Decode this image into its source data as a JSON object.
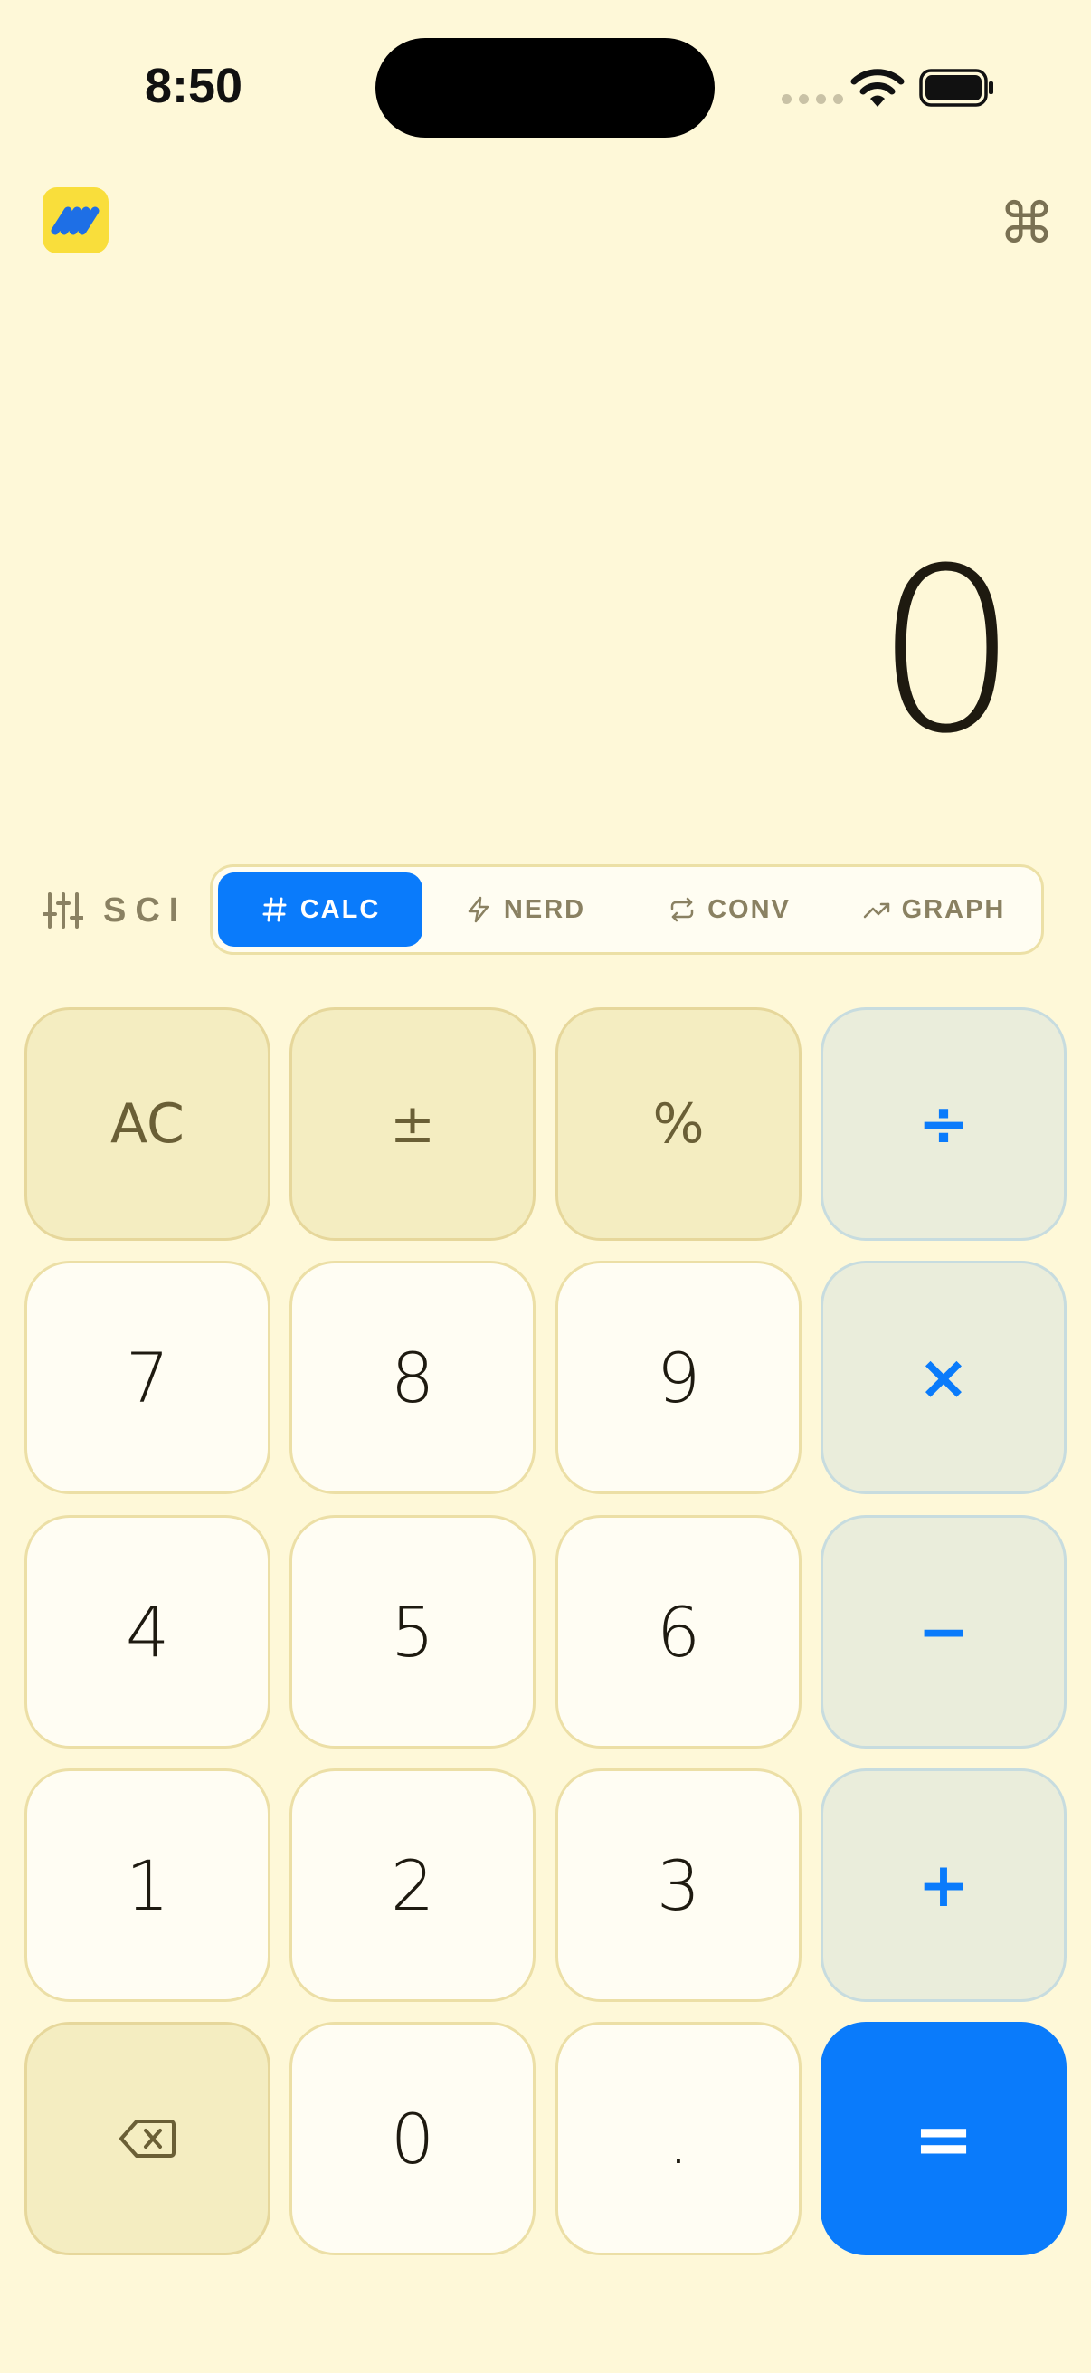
{
  "status_bar": {
    "time": "8:50"
  },
  "header": {
    "logo_icon": "app-logo-icon",
    "shortcut_icon": "command-icon",
    "shortcut_symbol": "⌘"
  },
  "display": {
    "value": "0"
  },
  "mode": {
    "sci_label": "SCI",
    "tabs": [
      {
        "label": "CALC",
        "icon": "hash-icon",
        "active": true
      },
      {
        "label": "NERD",
        "icon": "bolt-icon",
        "active": false
      },
      {
        "label": "CONV",
        "icon": "repeat-icon",
        "active": false
      },
      {
        "label": "GRAPH",
        "icon": "trend-icon",
        "active": false
      }
    ]
  },
  "keypad": {
    "ac": "AC",
    "sign": "±",
    "percent": "%",
    "divide": "÷",
    "seven": "7",
    "eight": "8",
    "nine": "9",
    "multiply": "×",
    "four": "4",
    "five": "5",
    "six": "6",
    "minus": "−",
    "one": "1",
    "two": "2",
    "three": "3",
    "plus": "+",
    "backspace_icon": "backspace-icon",
    "zero": "0",
    "decimal": ".",
    "equals": "="
  },
  "colors": {
    "background": "#FEF8D8",
    "accent": "#0A7BFB",
    "logo": "#F9DE3B"
  }
}
